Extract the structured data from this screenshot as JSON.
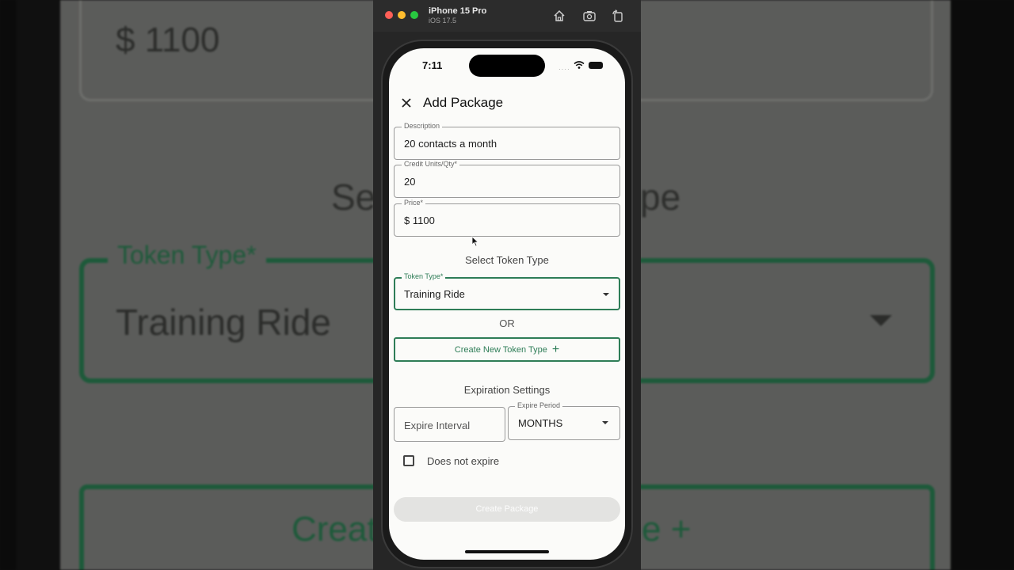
{
  "background": {
    "price": "$ 1100",
    "heading_left": "Se",
    "heading_right": "pe",
    "token_label": "Token Type*",
    "token_value": "Training Ride",
    "create_left": "Creat",
    "create_right": "e +"
  },
  "simulator": {
    "device": "iPhone 15 Pro",
    "os": "iOS 17.5",
    "icons": [
      "home-icon",
      "screenshot-icon",
      "rotate-icon"
    ]
  },
  "status_bar": {
    "time": "7:11",
    "signal": "····"
  },
  "app_bar": {
    "title": "Add Package"
  },
  "form": {
    "description": {
      "label": "Description",
      "value": "20 contacts a month"
    },
    "credit_units": {
      "label": "Credit Units/Qty*",
      "value": "20"
    },
    "price": {
      "label": "Price*",
      "value": "$ 1100"
    },
    "select_token_heading": "Select Token Type",
    "token_type": {
      "label": "Token Type*",
      "value": "Training Ride"
    },
    "or_text": "OR",
    "create_token_button": "Create New Token Type",
    "create_token_plus": "+",
    "expiration_heading": "Expiration Settings",
    "expire_interval": {
      "placeholder": "Expire Interval"
    },
    "expire_period": {
      "label": "Expire Period",
      "value": "MONTHS"
    },
    "does_not_expire": {
      "label": "Does not expire",
      "checked": false
    },
    "create_package_button": "Create Package"
  },
  "colors": {
    "accent": "#2e7d57",
    "screen_bg": "#fbfbf9",
    "disabled_button": "#e3e3e1"
  }
}
